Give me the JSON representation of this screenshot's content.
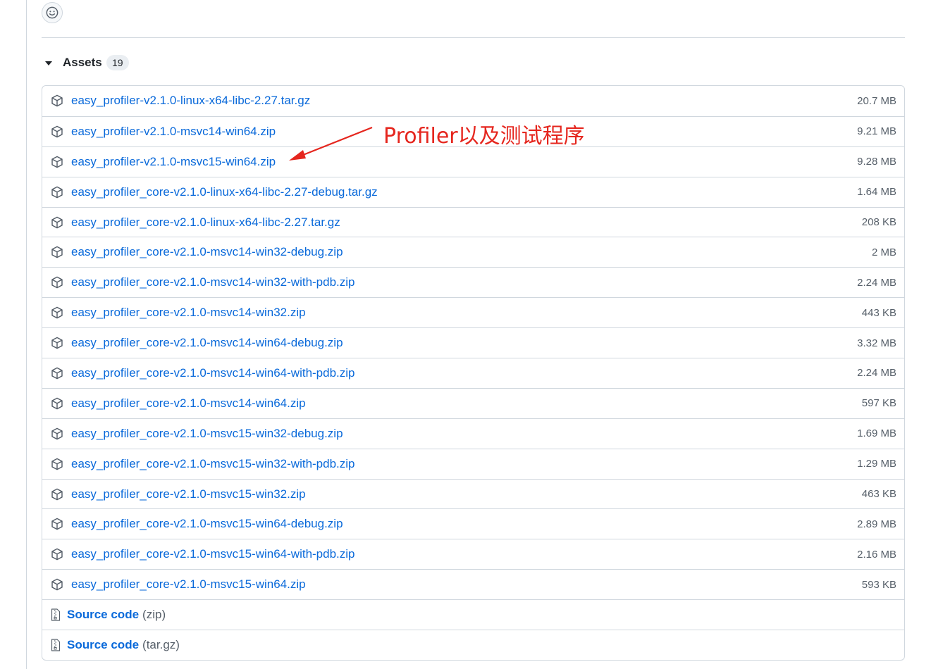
{
  "reaction": {
    "icon": "smiley-icon"
  },
  "assets": {
    "title": "Assets",
    "count": "19",
    "files": [
      {
        "name": "easy_profiler-v2.1.0-linux-x64-libc-2.27.tar.gz",
        "size": "20.7 MB"
      },
      {
        "name": "easy_profiler-v2.1.0-msvc14-win64.zip",
        "size": "9.21 MB"
      },
      {
        "name": "easy_profiler-v2.1.0-msvc15-win64.zip",
        "size": "9.28 MB"
      },
      {
        "name": "easy_profiler_core-v2.1.0-linux-x64-libc-2.27-debug.tar.gz",
        "size": "1.64 MB"
      },
      {
        "name": "easy_profiler_core-v2.1.0-linux-x64-libc-2.27.tar.gz",
        "size": "208 KB"
      },
      {
        "name": "easy_profiler_core-v2.1.0-msvc14-win32-debug.zip",
        "size": "2 MB"
      },
      {
        "name": "easy_profiler_core-v2.1.0-msvc14-win32-with-pdb.zip",
        "size": "2.24 MB"
      },
      {
        "name": "easy_profiler_core-v2.1.0-msvc14-win32.zip",
        "size": "443 KB"
      },
      {
        "name": "easy_profiler_core-v2.1.0-msvc14-win64-debug.zip",
        "size": "3.32 MB"
      },
      {
        "name": "easy_profiler_core-v2.1.0-msvc14-win64-with-pdb.zip",
        "size": "2.24 MB"
      },
      {
        "name": "easy_profiler_core-v2.1.0-msvc14-win64.zip",
        "size": "597 KB"
      },
      {
        "name": "easy_profiler_core-v2.1.0-msvc15-win32-debug.zip",
        "size": "1.69 MB"
      },
      {
        "name": "easy_profiler_core-v2.1.0-msvc15-win32-with-pdb.zip",
        "size": "1.29 MB"
      },
      {
        "name": "easy_profiler_core-v2.1.0-msvc15-win32.zip",
        "size": "463 KB"
      },
      {
        "name": "easy_profiler_core-v2.1.0-msvc15-win64-debug.zip",
        "size": "2.89 MB"
      },
      {
        "name": "easy_profiler_core-v2.1.0-msvc15-win64-with-pdb.zip",
        "size": "2.16 MB"
      },
      {
        "name": "easy_profiler_core-v2.1.0-msvc15-win64.zip",
        "size": "593 KB"
      }
    ],
    "source": [
      {
        "label": "Source code",
        "suffix": "(zip)"
      },
      {
        "label": "Source code",
        "suffix": "(tar.gz)"
      }
    ]
  },
  "annotation": {
    "text": "Profiler以及测试程序",
    "color": "#e5261e"
  },
  "colors": {
    "link": "#0969da",
    "muted": "#57606a",
    "border": "#d0d7de"
  }
}
